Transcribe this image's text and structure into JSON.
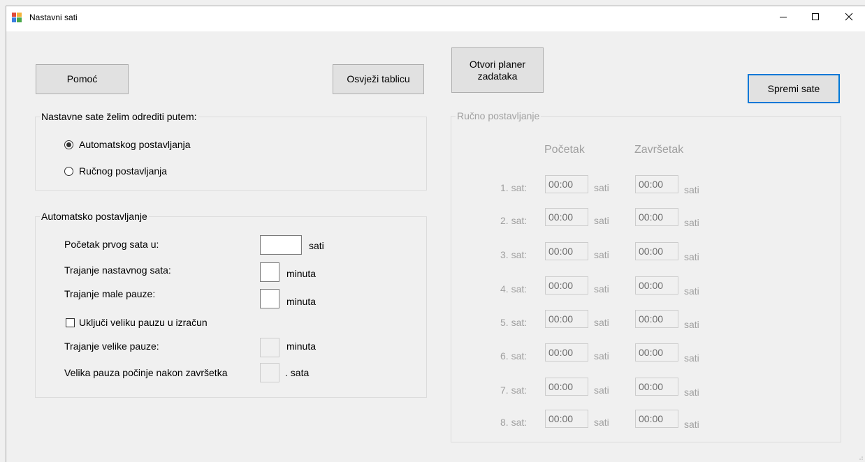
{
  "window": {
    "title": "Nastavni sati"
  },
  "toolbar": {
    "help_label": "Pomoć",
    "refresh_label": "Osvježi tablicu",
    "planner_label": "Otvori planer zadataka",
    "save_label": "Spremi sate"
  },
  "method_group": {
    "legend": "Nastavne sate želim odrediti putem:",
    "options": [
      {
        "label": "Automatskog postavljanja",
        "checked": true
      },
      {
        "label": "Ručnog postavljanja",
        "checked": false
      }
    ]
  },
  "auto_group": {
    "legend": "Automatsko postavljanje",
    "start_label": "Početak prvog sata u:",
    "start_value": "",
    "start_unit": "sati",
    "duration_label": "Trajanje nastavnog sata:",
    "duration_value": "",
    "duration_unit": "minuta",
    "short_break_label": "Trajanje male pauze:",
    "short_break_value": "",
    "short_break_unit": "minuta",
    "include_long_break_label": "Uključi veliku pauzu u izračun",
    "include_long_break_checked": false,
    "long_break_label": "Trajanje velike pauze:",
    "long_break_value": "",
    "long_break_unit": "minuta",
    "long_break_after_label": "Velika pauza počinje nakon završetka",
    "long_break_after_value": "",
    "long_break_after_unit": ". sata"
  },
  "manual_group": {
    "legend": "Ručno postavljanje",
    "start_header": "Početak",
    "end_header": "Završetak",
    "rows": [
      {
        "label": "1. sat:",
        "start": "00:00",
        "start_unit": "sati",
        "end": "00:00",
        "end_unit": "sati"
      },
      {
        "label": "2. sat:",
        "start": "00:00",
        "start_unit": "sati",
        "end": "00:00",
        "end_unit": "sati"
      },
      {
        "label": "3. sat:",
        "start": "00:00",
        "start_unit": "sati",
        "end": "00:00",
        "end_unit": "sati"
      },
      {
        "label": "4. sat:",
        "start": "00:00",
        "start_unit": "sati",
        "end": "00:00",
        "end_unit": "sati"
      },
      {
        "label": "5. sat:",
        "start": "00:00",
        "start_unit": "sati",
        "end": "00:00",
        "end_unit": "sati"
      },
      {
        "label": "6. sat:",
        "start": "00:00",
        "start_unit": "sati",
        "end": "00:00",
        "end_unit": "sati"
      },
      {
        "label": "7. sat:",
        "start": "00:00",
        "start_unit": "sati",
        "end": "00:00",
        "end_unit": "sati"
      },
      {
        "label": "8. sat:",
        "start": "00:00",
        "start_unit": "sati",
        "end": "00:00",
        "end_unit": "sati"
      }
    ]
  },
  "colors": {
    "accent": "#0078d7",
    "disabled_text": "#a0a0a0"
  }
}
